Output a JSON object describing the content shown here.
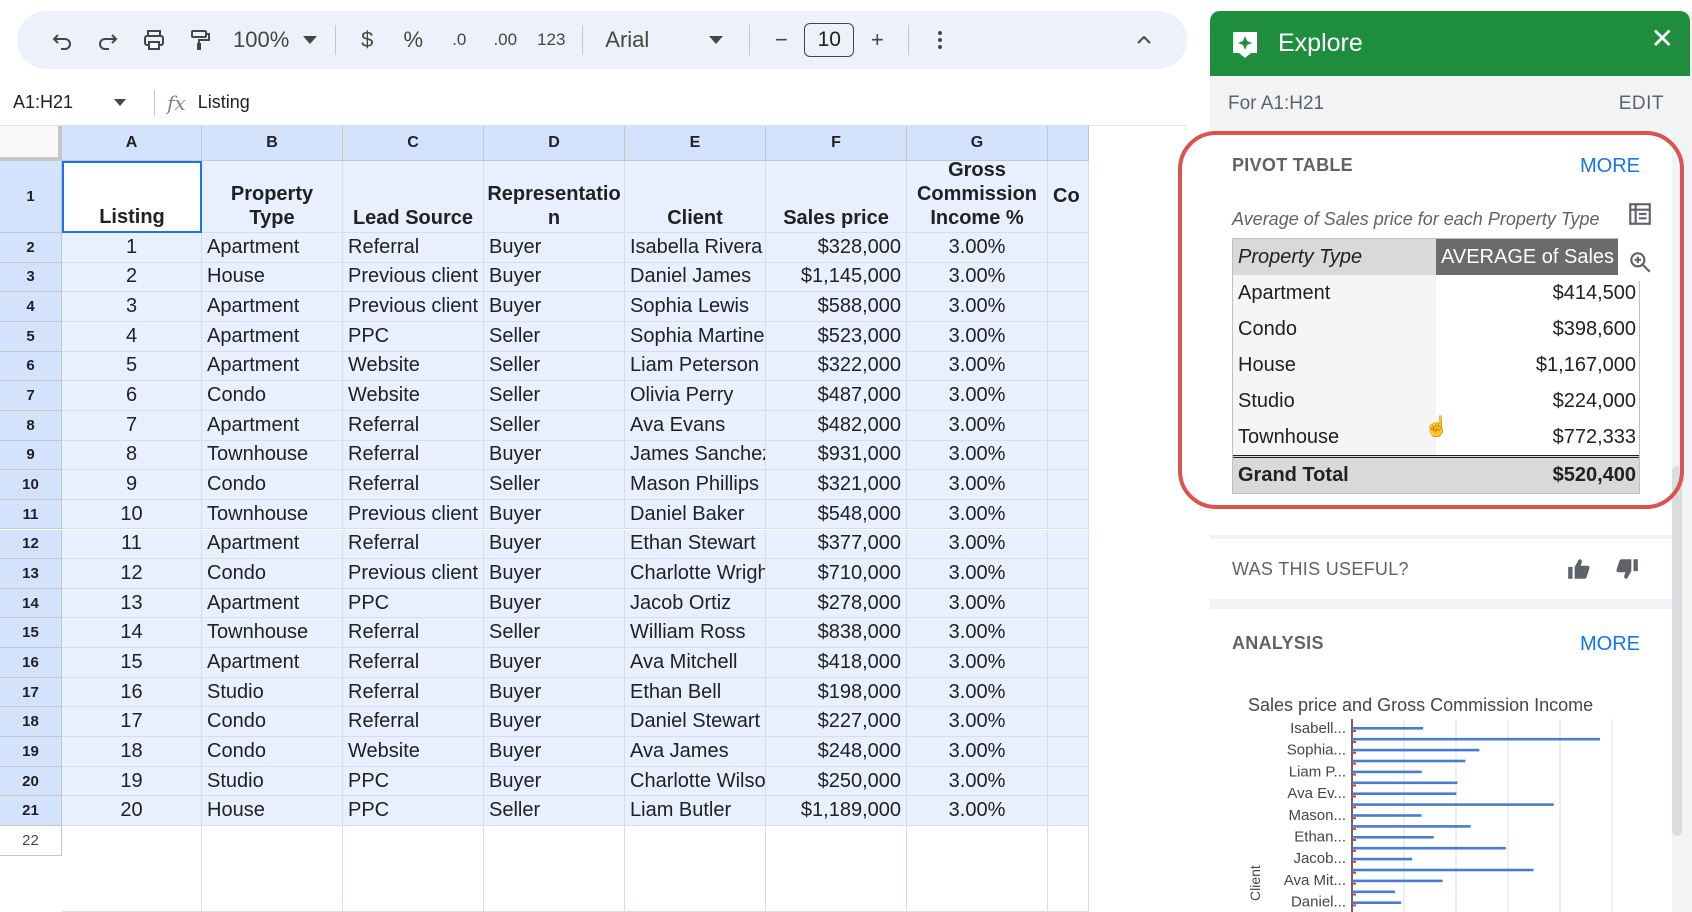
{
  "toolbar": {
    "zoom": "100%",
    "currency": "$",
    "percent": "%",
    "dec_decrease": ".0",
    "dec_increase": ".00",
    "number_format": "123",
    "font": "Arial",
    "font_size": "10",
    "minus": "−",
    "plus": "+"
  },
  "formula_bar": {
    "range": "A1:H21",
    "fx": "fx",
    "content": "Listing"
  },
  "columns": [
    "A",
    "B",
    "C",
    "D",
    "E",
    "F",
    "G"
  ],
  "header_row": [
    "Listing",
    "Property Type",
    "Lead Source",
    "Representatio n",
    "Client",
    "Sales price",
    "Gross Commission Income %",
    "Co"
  ],
  "row_numbers": [
    "1",
    "2",
    "3",
    "4",
    "5",
    "6",
    "7",
    "8",
    "9",
    "10",
    "11",
    "12",
    "13",
    "14",
    "15",
    "16",
    "17",
    "18",
    "19",
    "20",
    "21",
    "22"
  ],
  "rows": [
    [
      "1",
      "Apartment",
      "Referral",
      "Buyer",
      "Isabella Rivera",
      "$328,000",
      "3.00%"
    ],
    [
      "2",
      "House",
      "Previous client",
      "Buyer",
      "Daniel James",
      "$1,145,000",
      "3.00%"
    ],
    [
      "3",
      "Apartment",
      "Previous client",
      "Buyer",
      "Sophia Lewis",
      "$588,000",
      "3.00%"
    ],
    [
      "4",
      "Apartment",
      "PPC",
      "Seller",
      "Sophia Martinez",
      "$523,000",
      "3.00%"
    ],
    [
      "5",
      "Apartment",
      "Website",
      "Seller",
      "Liam Peterson",
      "$322,000",
      "3.00%"
    ],
    [
      "6",
      "Condo",
      "Website",
      "Seller",
      "Olivia Perry",
      "$487,000",
      "3.00%"
    ],
    [
      "7",
      "Apartment",
      "Referral",
      "Seller",
      "Ava Evans",
      "$482,000",
      "3.00%"
    ],
    [
      "8",
      "Townhouse",
      "Referral",
      "Buyer",
      "James Sanchez",
      "$931,000",
      "3.00%"
    ],
    [
      "9",
      "Condo",
      "Referral",
      "Seller",
      "Mason Phillips",
      "$321,000",
      "3.00%"
    ],
    [
      "10",
      "Townhouse",
      "Previous client",
      "Buyer",
      "Daniel Baker",
      "$548,000",
      "3.00%"
    ],
    [
      "11",
      "Apartment",
      "Referral",
      "Buyer",
      "Ethan Stewart",
      "$377,000",
      "3.00%"
    ],
    [
      "12",
      "Condo",
      "Previous client",
      "Buyer",
      "Charlotte Wright",
      "$710,000",
      "3.00%"
    ],
    [
      "13",
      "Apartment",
      "PPC",
      "Buyer",
      "Jacob Ortiz",
      "$278,000",
      "3.00%"
    ],
    [
      "14",
      "Townhouse",
      "Referral",
      "Seller",
      "William Ross",
      "$838,000",
      "3.00%"
    ],
    [
      "15",
      "Apartment",
      "Referral",
      "Buyer",
      "Ava Mitchell",
      "$418,000",
      "3.00%"
    ],
    [
      "16",
      "Studio",
      "Referral",
      "Buyer",
      "Ethan Bell",
      "$198,000",
      "3.00%"
    ],
    [
      "17",
      "Condo",
      "Referral",
      "Buyer",
      "Daniel Stewart",
      "$227,000",
      "3.00%"
    ],
    [
      "18",
      "Condo",
      "Website",
      "Buyer",
      "Ava James",
      "$248,000",
      "3.00%"
    ],
    [
      "19",
      "Studio",
      "PPC",
      "Buyer",
      "Charlotte Wilson",
      "$250,000",
      "3.00%"
    ],
    [
      "20",
      "House",
      "PPC",
      "Seller",
      "Liam Butler",
      "$1,189,000",
      "3.00%"
    ]
  ],
  "explore": {
    "title": "Explore",
    "range_label": "For A1:H21",
    "edit": "EDIT",
    "pivot": {
      "title": "PIVOT TABLE",
      "more": "MORE",
      "caption": "Average of Sales price for each Property Type",
      "col1": "Property Type",
      "col2": "AVERAGE of Sales pr",
      "rows": [
        {
          "label": "Apartment",
          "value": "$414,500"
        },
        {
          "label": "Condo",
          "value": "$398,600"
        },
        {
          "label": "House",
          "value": "$1,167,000"
        },
        {
          "label": "Studio",
          "value": "$224,000"
        },
        {
          "label": "Townhouse",
          "value": "$772,333"
        }
      ],
      "total_label": "Grand Total",
      "total_value": "$520,400"
    },
    "useful": "WAS THIS USEFUL?",
    "analysis": {
      "title": "ANALYSIS",
      "more": "MORE"
    }
  },
  "chart_data": {
    "type": "bar",
    "title": "Sales price and Gross Commission Income",
    "ylabel": "Client",
    "categories": [
      "Isabell...",
      "Sophia...",
      "Liam P...",
      "Ava Ev...",
      "Mason...",
      "Ethan...",
      "Jacob...",
      "Ava Mit...",
      "Daniel..."
    ],
    "all_bars": [
      328000,
      1145000,
      588000,
      523000,
      322000,
      487000,
      482000,
      931000,
      321000,
      548000,
      377000,
      710000,
      278000,
      838000,
      418000,
      198000,
      227000
    ],
    "xlim": [
      0,
      1200000
    ],
    "colors": {
      "sales": "#4a7bd0",
      "gci": "#e53935"
    }
  }
}
